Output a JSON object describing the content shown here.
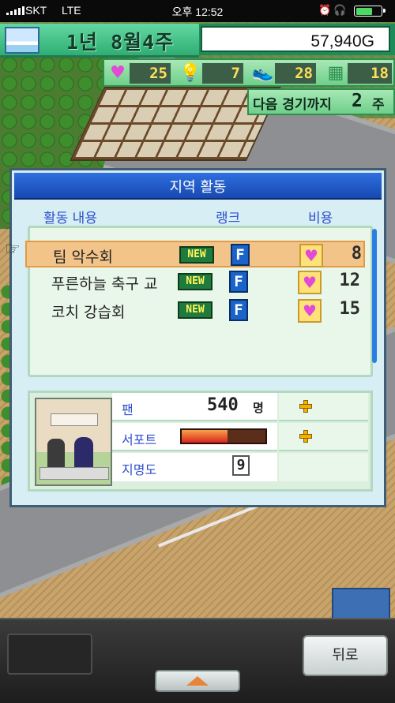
{
  "status_bar": {
    "carrier": "SKT",
    "network": "LTE",
    "time": "오후 12:52",
    "alarm_icon": "alarm-icon",
    "headphone_icon": "headphones-icon",
    "battery_level": 0.7
  },
  "hud": {
    "date": "1년 8월4주",
    "money": "57,940G",
    "stats": [
      {
        "icon": "heart-icon",
        "glyph": "♥",
        "color": "#e04ad6",
        "value": "25"
      },
      {
        "icon": "lightbulb-icon",
        "glyph": "💡",
        "color": "#f0d040",
        "value": "7"
      },
      {
        "icon": "sneaker-icon",
        "glyph": "👟",
        "color": "#f0c030",
        "value": "28"
      },
      {
        "icon": "field-icon",
        "glyph": "▦",
        "color": "#2f8f51",
        "value": "18"
      }
    ],
    "next_game": {
      "label": "다음 경기까지",
      "value": "2",
      "unit": "주"
    }
  },
  "dialog": {
    "title": "지역 활동",
    "headers": {
      "activity": "활동 내용",
      "rank": "랭크",
      "cost": "비용"
    },
    "activities": [
      {
        "name": "팀 악수회",
        "badge": "NEW",
        "rank": "F",
        "cost": "8",
        "selected": true
      },
      {
        "name": "푸른하늘 축구 교",
        "badge": "NEW",
        "rank": "F",
        "cost": "12",
        "selected": false
      },
      {
        "name": "코치 강습회",
        "badge": "NEW",
        "rank": "F",
        "cost": "15",
        "selected": false
      }
    ],
    "info": {
      "fans_label": "팬",
      "fans_value": "540",
      "fans_unit": "명",
      "support_label": "서포트",
      "support_level": 0.55,
      "fame_label": "지명도",
      "fame_value": "9"
    }
  },
  "bottom": {
    "back_label": "뒤로"
  },
  "colors": {
    "accent_blue": "#2e6fe0",
    "hud_green": "#2fae73",
    "selected_row": "#f2c48a"
  }
}
